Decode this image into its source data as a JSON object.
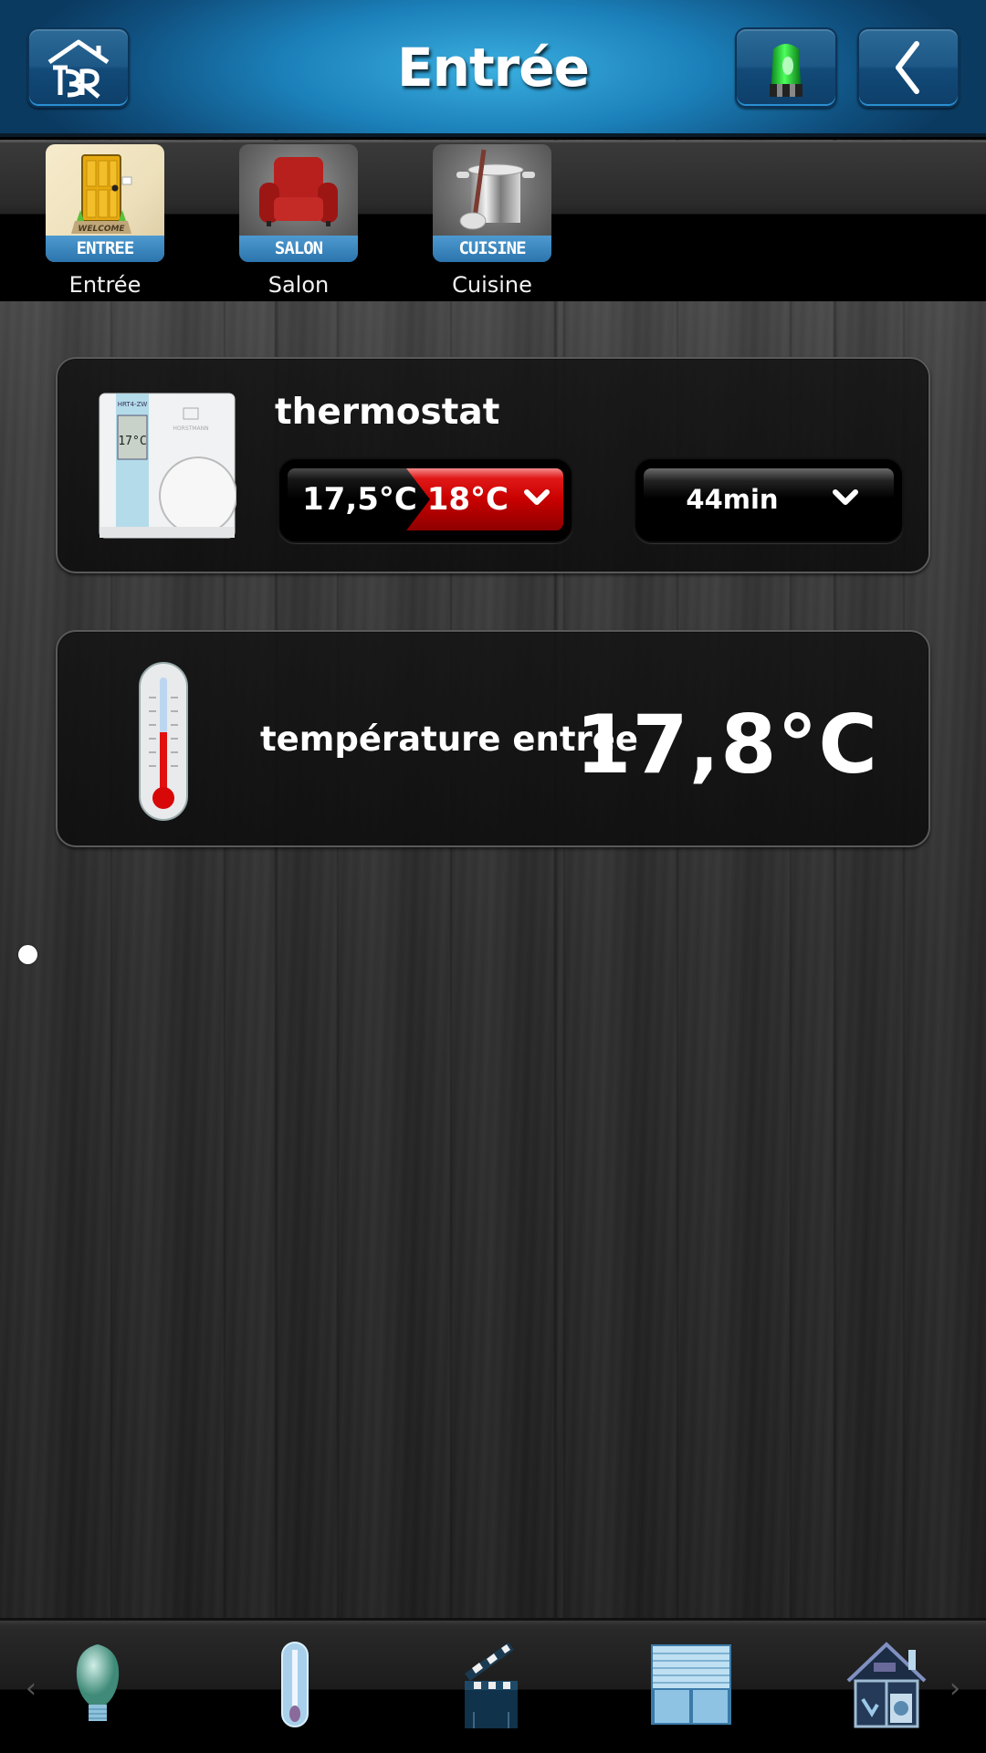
{
  "header": {
    "title": "Entrée",
    "logo_icon": "house-br-logo-icon",
    "alarm_icon": "green-alarm-beacon-icon",
    "back_icon": "chevron-left-icon"
  },
  "rooms": [
    {
      "tile_text": "ENTREE",
      "label": "Entrée",
      "icon": "door-welcome-icon",
      "selected": true
    },
    {
      "tile_text": "SALON",
      "label": "Salon",
      "icon": "armchair-icon",
      "selected": false
    },
    {
      "tile_text": "CUISINE",
      "label": "Cuisine",
      "icon": "cooking-pot-icon",
      "selected": false
    }
  ],
  "devices": {
    "thermostat": {
      "title": "thermostat",
      "device_model": "HRT4-ZW",
      "device_brand": "HORSTMANN",
      "device_display": "17°C",
      "current_temp": "17,5°C",
      "setpoint": "18°C",
      "timer": "44min",
      "accent_color": "#c80000"
    },
    "temperature": {
      "title": "température entrée",
      "value": "17,8°C"
    }
  },
  "pager": {
    "pages": 1,
    "current": 1
  },
  "bottom_nav": {
    "items": [
      {
        "name": "lights",
        "icon": "light-bulb-icon"
      },
      {
        "name": "heating",
        "icon": "thermometer-icon"
      },
      {
        "name": "scenes",
        "icon": "clapperboard-icon"
      },
      {
        "name": "shutters",
        "icon": "roller-shutter-icon"
      },
      {
        "name": "house",
        "icon": "house-appliances-icon"
      }
    ],
    "prev_arrow": "‹",
    "next_arrow": "›"
  }
}
